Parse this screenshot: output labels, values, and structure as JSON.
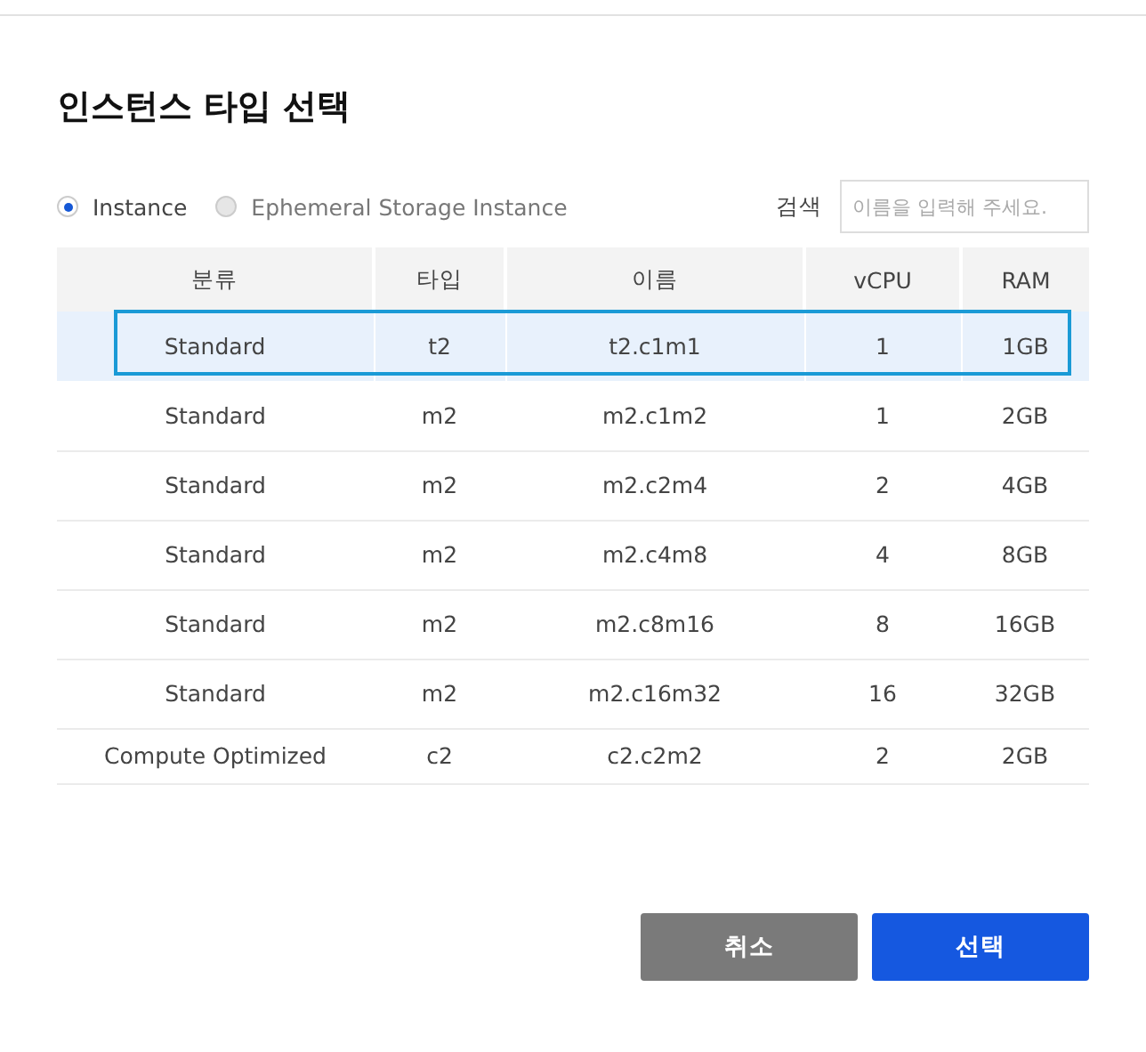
{
  "dialog": {
    "title": "인스턴스 타입 선택"
  },
  "filters": [
    {
      "label": "Instance",
      "selected": true
    },
    {
      "label": "Ephemeral Storage Instance",
      "selected": false
    }
  ],
  "search": {
    "label": "검색",
    "placeholder": "이름을 입력해 주세요."
  },
  "table": {
    "columns": [
      "분류",
      "타입",
      "이름",
      "vCPU",
      "RAM"
    ],
    "rows": [
      {
        "cells": [
          "Standard",
          "t2",
          "t2.c1m1",
          "1",
          "1GB"
        ],
        "selected": true
      },
      {
        "cells": [
          "Standard",
          "m2",
          "m2.c1m2",
          "1",
          "2GB"
        ],
        "selected": false
      },
      {
        "cells": [
          "Standard",
          "m2",
          "m2.c2m4",
          "2",
          "4GB"
        ],
        "selected": false
      },
      {
        "cells": [
          "Standard",
          "m2",
          "m2.c4m8",
          "4",
          "8GB"
        ],
        "selected": false
      },
      {
        "cells": [
          "Standard",
          "m2",
          "m2.c8m16",
          "8",
          "16GB"
        ],
        "selected": false
      },
      {
        "cells": [
          "Standard",
          "m2",
          "m2.c16m32",
          "16",
          "32GB"
        ],
        "selected": false
      },
      {
        "cells": [
          "Compute Optimized",
          "c2",
          "c2.c2m2",
          "2",
          "2GB"
        ],
        "selected": false
      }
    ]
  },
  "buttons": [
    {
      "label": "취소",
      "kind": "secondary"
    },
    {
      "label": "선택",
      "kind": "primary"
    }
  ]
}
